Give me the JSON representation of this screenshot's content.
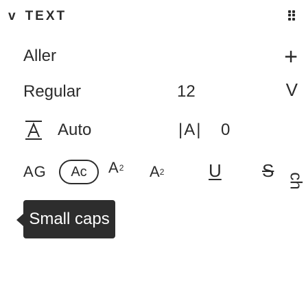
{
  "panel": {
    "section_title": "TEXT",
    "collapse_glyph": "v",
    "font_family": "Aller",
    "font_style": "Regular",
    "font_size": "12",
    "add_glyph": "+",
    "dropdown_glyph": "V",
    "decrease_glyph": "<",
    "line_height_value": "Auto",
    "tracking_glyph": "|A|",
    "tracking_value": "0",
    "icons": {
      "collapse": "chevron-down-icon",
      "drag": "grip-handle-icon",
      "add": "plus-icon",
      "line_height": "line-height-icon",
      "tracking": "letter-spacing-icon"
    }
  },
  "features": {
    "all_caps": "AG",
    "small_caps": "Ac",
    "superscript_base": "A",
    "superscript_mark": "2",
    "subscript_base": "A",
    "subscript_mark": "2",
    "underline": "U",
    "strikethrough": "S",
    "ligature": "ch"
  },
  "tooltip": {
    "text": "Small caps"
  },
  "colors": {
    "foreground": "#2b2b2b",
    "tooltip_bg": "#2d2d2d",
    "tooltip_text": "#ffffff"
  }
}
